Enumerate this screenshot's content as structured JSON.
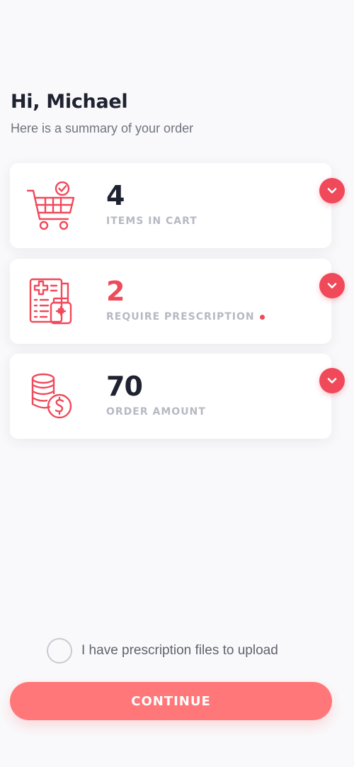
{
  "header": {
    "greeting": "Hi, Michael",
    "subtitle": "Here is a summary of your order"
  },
  "cards": [
    {
      "value": "4",
      "label": "ITEMS IN CART",
      "icon": "shopping-cart-check-icon"
    },
    {
      "value": "2",
      "label": "REQUIRE PRESCRIPTION",
      "icon": "prescription-icon",
      "indicator": "red-dot"
    },
    {
      "value": "70",
      "label": "ORDER AMOUNT",
      "icon": "coins-dollar-icon"
    }
  ],
  "upload": {
    "label": "I have prescription files to upload",
    "checked": false
  },
  "actions": {
    "continue_label": "CONTINUE"
  },
  "colors": {
    "accent": "#f0495a",
    "button": "#ff7779",
    "text_dark": "#1f2230",
    "text_muted": "#b7b9c3",
    "background": "#f9f9fb"
  }
}
